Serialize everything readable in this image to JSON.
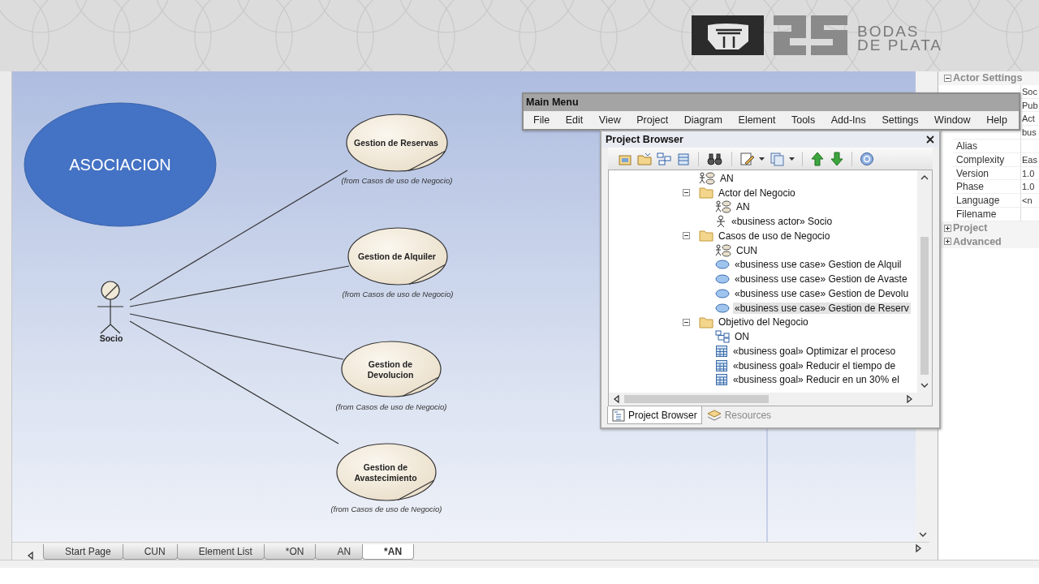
{
  "banner": {
    "logo_text": [
      "BODAS",
      "DE PLATA"
    ]
  },
  "diagram": {
    "note": "ASOCIACION",
    "actor": {
      "name": "Socio"
    },
    "use_cases": [
      {
        "lines": [
          "Gestion de Reservas"
        ],
        "origin": "(from Casos de uso de Negocio)"
      },
      {
        "lines": [
          "Gestion de Alquiler"
        ],
        "origin": "(from Casos de uso de Negocio)"
      },
      {
        "lines": [
          "Gestion de",
          "Devolucion"
        ],
        "origin": "(from Casos de uso de Negocio)"
      },
      {
        "lines": [
          "Gestion de",
          "Avastecimiento"
        ],
        "origin": "(from Casos de uso de Negocio)"
      }
    ]
  },
  "document_tabs": [
    {
      "label": "Start Page",
      "selected": false
    },
    {
      "label": "CUN",
      "selected": false
    },
    {
      "label": "Element List",
      "selected": false
    },
    {
      "label": "*ON",
      "selected": false
    },
    {
      "label": "AN",
      "selected": false
    },
    {
      "label": "*AN",
      "selected": true
    }
  ],
  "main_menu": {
    "title": "Main Menu",
    "items": [
      "File",
      "Edit",
      "View",
      "Project",
      "Diagram",
      "Element",
      "Tools",
      "Add-Ins",
      "Settings",
      "Window",
      "Help"
    ]
  },
  "project_browser": {
    "title": "Project Browser",
    "tree": [
      {
        "kind": "diagram",
        "label": "AN",
        "selected": false
      },
      {
        "kind": "folder",
        "label": "Actor del Negocio",
        "selected": false,
        "expanded": true,
        "children": [
          {
            "kind": "diagram",
            "label": "AN",
            "selected": false
          },
          {
            "kind": "actor",
            "label": "«business actor» Socio",
            "selected": false
          }
        ]
      },
      {
        "kind": "folder",
        "label": "Casos de uso de Negocio",
        "selected": false,
        "expanded": true,
        "children": [
          {
            "kind": "diagram",
            "label": "CUN",
            "selected": false
          },
          {
            "kind": "usecase",
            "label": "«business use case» Gestion de Alquil",
            "selected": false
          },
          {
            "kind": "usecase",
            "label": "«business use case» Gestion de Avaste",
            "selected": false
          },
          {
            "kind": "usecase",
            "label": "«business use case» Gestion de Devolu",
            "selected": false
          },
          {
            "kind": "usecase",
            "label": "«business use case» Gestion de Reserv",
            "selected": true
          }
        ]
      },
      {
        "kind": "folder",
        "label": "Objetivo del Negocio",
        "selected": false,
        "expanded": true,
        "children": [
          {
            "kind": "hierarchy",
            "label": "ON",
            "selected": false
          },
          {
            "kind": "goal",
            "label": "«business goal» Optimizar el proceso",
            "selected": false
          },
          {
            "kind": "goal",
            "label": "«business goal» Reducir el tiempo de",
            "selected": false
          },
          {
            "kind": "goal",
            "label": "«business goal» Reducir en un 30% el",
            "selected": false
          }
        ]
      }
    ],
    "tabs": [
      {
        "label": "Project Browser",
        "selected": true
      },
      {
        "label": "Resources",
        "selected": false
      }
    ]
  },
  "properties": {
    "sections": [
      {
        "title": "Actor Settings",
        "expanded": true,
        "rows": [
          {
            "value": "Soc"
          },
          {
            "value": "Pub"
          },
          {
            "value": "Act"
          },
          {
            "value": "bus"
          },
          {
            "label": "Alias"
          },
          {
            "label": "Complexity",
            "value": "Eas"
          },
          {
            "label": "Version",
            "value": "1.0"
          },
          {
            "label": "Phase",
            "value": "1.0"
          },
          {
            "label": "Language",
            "value": "<n"
          },
          {
            "label": "Filename"
          }
        ]
      },
      {
        "title": "Project",
        "expanded": false
      },
      {
        "title": "Advanced",
        "expanded": false
      }
    ]
  }
}
